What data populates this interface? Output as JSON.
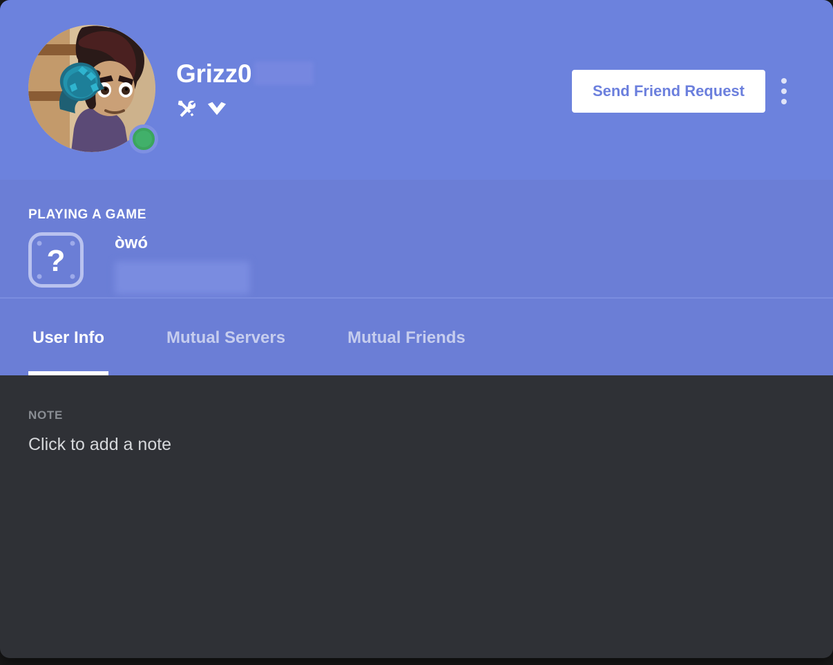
{
  "card": {
    "accent_color": "#6c82dd",
    "body_color": "#6b7ed6",
    "note_bg_color": "#2f3136"
  },
  "header": {
    "username": "Grizz0",
    "discriminator_hidden": true,
    "status": "online",
    "status_color": "#3ba55d",
    "avatar_alt": "cartoon-character-avatar",
    "badges": [
      {
        "name": "hammer-and-wrench-badge"
      },
      {
        "name": "hypesquad-bravery-badge"
      }
    ],
    "send_friend_request_label": "Send Friend Request",
    "more_options_label": "More"
  },
  "activity": {
    "section_title": "PLAYING A GAME",
    "game_icon": "question-mark-game-icon",
    "game_name": "òwó",
    "detail_hidden": true
  },
  "tabs": [
    {
      "label": "User Info",
      "active": true
    },
    {
      "label": "Mutual Servers",
      "active": false
    },
    {
      "label": "Mutual Friends",
      "active": false
    }
  ],
  "note": {
    "label": "NOTE",
    "value": "",
    "placeholder": "Click to add a note"
  }
}
